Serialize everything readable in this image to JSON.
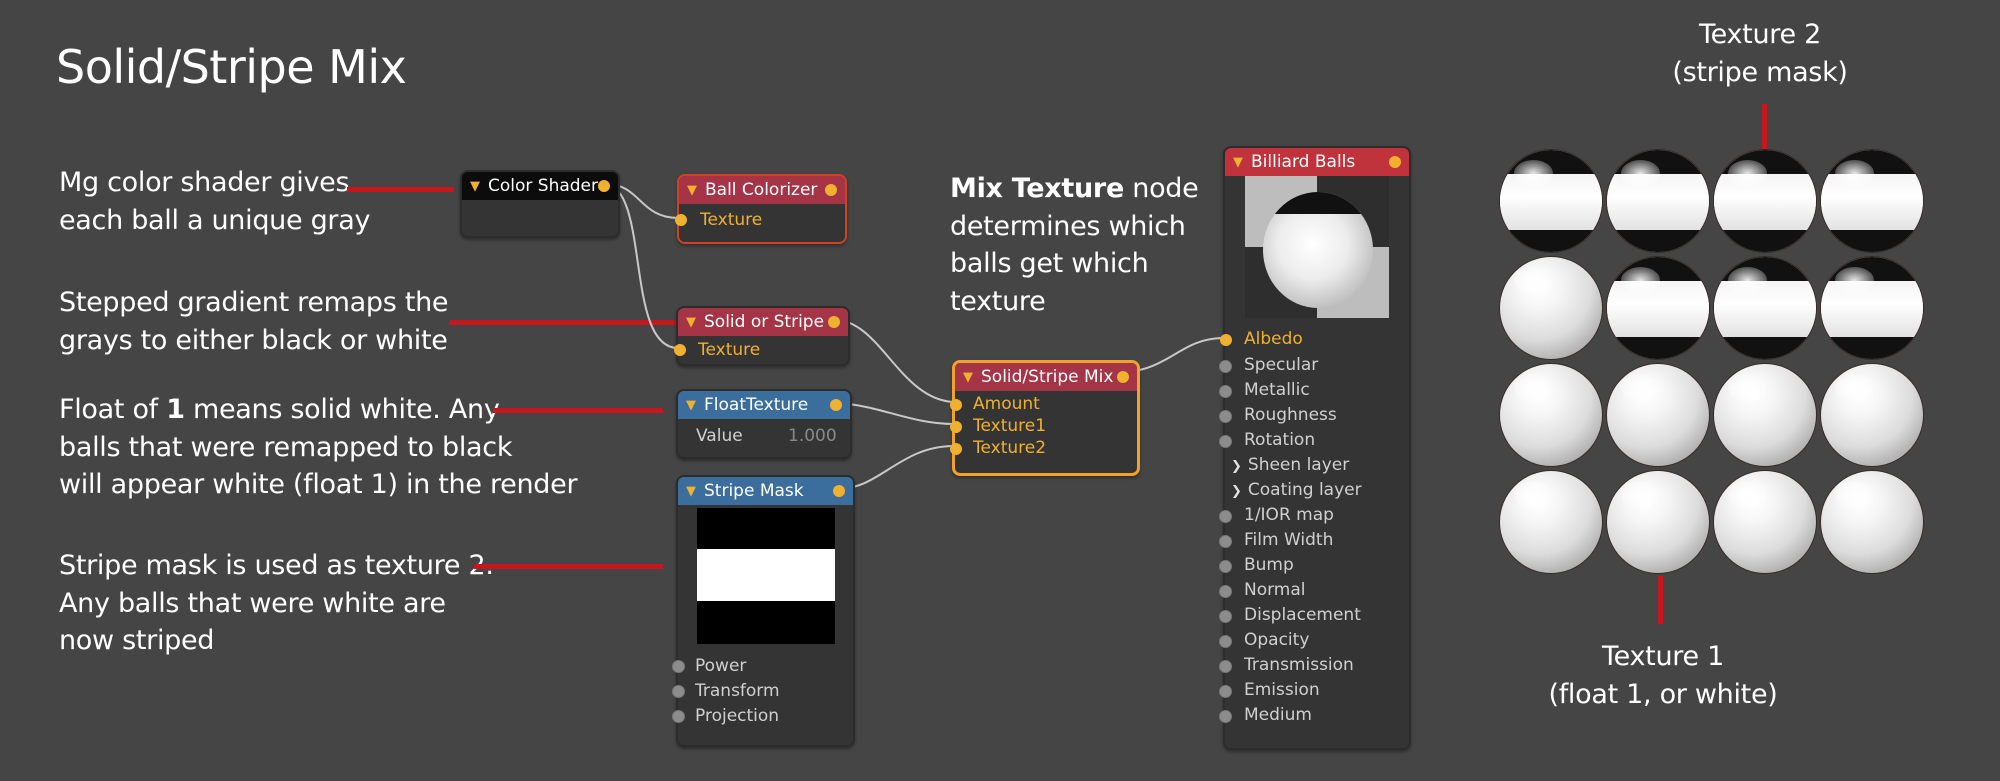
{
  "title": "Solid/Stripe Mix",
  "annotations": {
    "color_shader": [
      "Mg color shader gives",
      "each ball a unique gray"
    ],
    "stepped": [
      "Stepped  gradient remaps the",
      "grays to either black or white"
    ],
    "float_line1_pre": "Float of ",
    "float_line1_bold": "1",
    "float_line1_post": " means solid white. Any",
    "float_line2": "balls that were remapped to black",
    "float_line3": "will appear white (float 1) in the render",
    "stripe": [
      "Stripe mask is used as texture 2.",
      "Any balls that were white are",
      "now striped"
    ],
    "mix_bold": "Mix Texture",
    "mix_rest1": " node",
    "mix_lines": [
      "determines which",
      "balls get which",
      "texture"
    ],
    "texture2": [
      "Texture 2",
      "(stripe mask)"
    ],
    "texture1": [
      "Texture 1",
      "(float 1, or white)"
    ]
  },
  "nodes": {
    "color_shader": {
      "title": "Color Shader"
    },
    "ball_colorizer": {
      "title": "Ball Colorizer",
      "input": "Texture"
    },
    "solid_or_stripe": {
      "title": "Solid or Stripe",
      "input": "Texture"
    },
    "float_texture": {
      "title": "FloatTexture",
      "param_label": "Value",
      "param_value": "1.000"
    },
    "stripe_mask": {
      "title": "Stripe Mask",
      "inputs": [
        "Power",
        "Transform",
        "Projection"
      ]
    },
    "mix": {
      "title": "Solid/Stripe Mix",
      "inputs": [
        "Amount",
        "Texture1",
        "Texture2"
      ]
    },
    "billiard": {
      "title": "Billiard Balls",
      "albedo": "Albedo",
      "inputs": [
        "Specular",
        "Metallic",
        "Roughness",
        "Rotation"
      ],
      "groups": [
        "Sheen layer",
        "Coating layer"
      ],
      "inputs2": [
        "1/IOR map",
        "Film Width",
        "Bump",
        "Normal",
        "Displacement",
        "Opacity",
        "Transmission",
        "Emission",
        "Medium"
      ]
    }
  },
  "colors": {
    "background": "#454545",
    "annotation_line": "#c8161e",
    "port": "#f0b030",
    "node_header_red": "#a53447",
    "node_header_blue": "#3b6e9c",
    "selection_orange": "#f0a22a"
  },
  "render_grid": {
    "rows": 4,
    "cols": 4,
    "striped": [
      [
        true,
        true,
        true,
        true
      ],
      [
        false,
        true,
        true,
        true
      ],
      [
        false,
        false,
        false,
        false
      ],
      [
        false,
        false,
        false,
        false
      ]
    ]
  }
}
